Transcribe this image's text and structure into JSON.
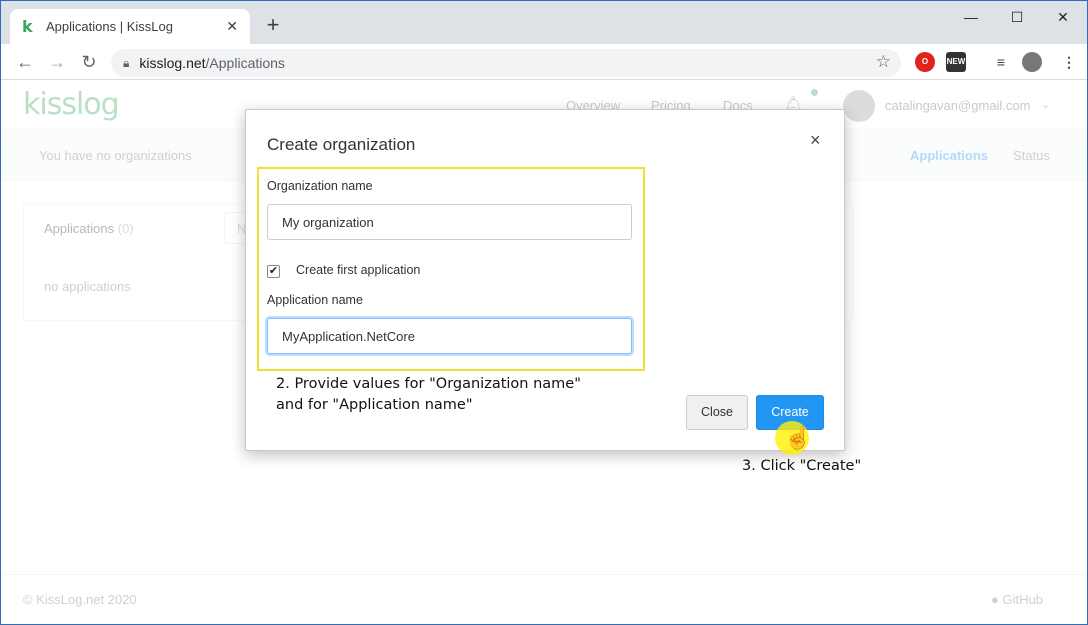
{
  "browser": {
    "tab_title": "Applications | KissLog",
    "tab_favicon": "k",
    "tab_close": "✕",
    "new_tab": "+",
    "url_host": "kisslog.net",
    "url_path": "/Applications",
    "window_controls": {
      "minimize": "—",
      "maximize": "☐",
      "close": "✕"
    }
  },
  "site": {
    "logo": "kisslog",
    "nav": [
      "Overview",
      "Pricing",
      "Docs"
    ],
    "user_email": "catalingavan@gmail.com",
    "org_select": "You have no organizations",
    "tabs": [
      "Applications",
      "Status"
    ],
    "card_title": "Applications",
    "card_count": "(0)",
    "card_search_placeholder": "N",
    "empty_text": "no applications",
    "footer_copy": "© KissLog.net 2020",
    "footer_github": "GitHub"
  },
  "modal": {
    "title": "Create organization",
    "close_icon": "×",
    "org_label": "Organization name",
    "org_value": "My organization",
    "checkbox_checked": true,
    "checkbox_label": "Create first application",
    "app_label": "Application name",
    "app_value": "MyApplication.NetCore",
    "close_button": "Close",
    "create_button": "Create"
  },
  "annotations": {
    "step2_line1": "2. Provide values for \"Organization name\"",
    "step2_line2": "and for \"Application name\"",
    "step3": "3. Click \"Create\""
  },
  "colors": {
    "primary": "#2196f3",
    "highlight": "#f0e12a",
    "brand": "#3aa757"
  }
}
